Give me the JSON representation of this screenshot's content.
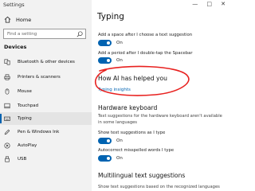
{
  "window": {
    "title": "Settings",
    "controls": [
      "—",
      "□",
      "✕"
    ]
  },
  "sidebar": {
    "home_label": "Home",
    "search_placeholder": "Find a setting",
    "section_header": "Devices",
    "items": [
      {
        "label": "Bluetooth & other devices",
        "icon": "bluetooth-icon"
      },
      {
        "label": "Printers & scanners",
        "icon": "printer-icon"
      },
      {
        "label": "Mouse",
        "icon": "mouse-icon"
      },
      {
        "label": "Touchpad",
        "icon": "touchpad-icon"
      },
      {
        "label": "Typing",
        "icon": "keyboard-icon",
        "selected": true
      },
      {
        "label": "Pen & Windows Ink",
        "icon": "pen-icon"
      },
      {
        "label": "AutoPlay",
        "icon": "autoplay-icon"
      },
      {
        "label": "USB",
        "icon": "usb-icon"
      }
    ]
  },
  "main": {
    "title": "Typing",
    "settings": [
      {
        "label": "Add a space after I choose a text suggestion",
        "state": "On"
      },
      {
        "label": "Add a period after I double-tap the Spacebar",
        "state": "On"
      }
    ],
    "insights_section": {
      "heading": "How AI has helped you",
      "link": "Typing insights"
    },
    "hardware_keyboard": {
      "heading": "Hardware keyboard",
      "description": "Text suggestions for the hardware keyboard aren't available in some languages",
      "settings": [
        {
          "label": "Show text suggestions as I type",
          "state": "On"
        },
        {
          "label": "Autocorrect misspelled words I type",
          "state": "On"
        }
      ]
    },
    "multilingual": {
      "heading": "Multilingual text suggestions",
      "description": "Show text suggestions based on the recognized languages you're"
    }
  },
  "colors": {
    "accent": "#0063b1",
    "annotation": "#e8211f",
    "sidebar_bg": "#f2f2f2"
  }
}
